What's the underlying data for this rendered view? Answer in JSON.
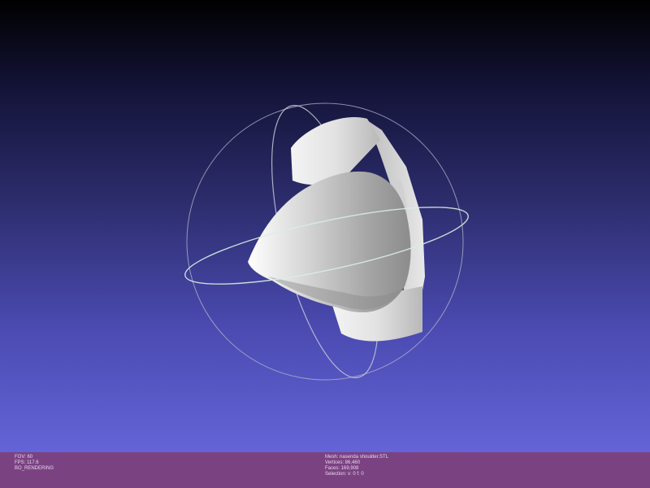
{
  "viewer": {
    "colors": {
      "background_top": "#000000",
      "background_bottom": "#6464d8",
      "mesh": "#d8d8d8",
      "trackball": "#c8c8d8",
      "status_bar": "#7b4282"
    }
  },
  "status_left": {
    "fov": "FOV: 60",
    "fps": "FPS:   117.6",
    "mode": "BO_RENDERING"
  },
  "status_right": {
    "mesh": "Mesh: nasenda shoulder.STL",
    "vertices": "Vertices: 86,460",
    "faces": "Faces: 169,908",
    "selection": "Selection: v: 0 f: 0"
  }
}
